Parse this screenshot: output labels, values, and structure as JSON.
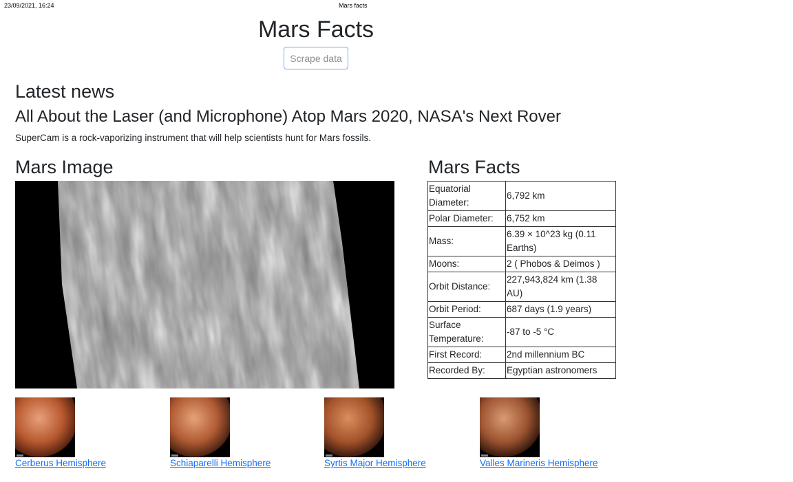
{
  "print_header": {
    "date": "23/09/2021, 16:24",
    "title": "Mars facts"
  },
  "page_title": "Mars Facts",
  "scrape_button": "Scrape data",
  "news": {
    "heading": "Latest news",
    "title": "All About the Laser (and Microphone) Atop Mars 2020, NASA's Next Rover",
    "paragraph": "SuperCam is a rock-vaporizing instrument that will help scientists hunt for Mars fossils."
  },
  "image_section": {
    "heading": "Mars Image"
  },
  "facts_section": {
    "heading": "Mars Facts",
    "rows": [
      {
        "label": "Equatorial Diameter:",
        "value": "6,792 km"
      },
      {
        "label": "Polar Diameter:",
        "value": "6,752 km"
      },
      {
        "label": "Mass:",
        "value": "6.39 × 10^23 kg (0.11 Earths)"
      },
      {
        "label": "Moons:",
        "value": "2 ( Phobos & Deimos )"
      },
      {
        "label": "Orbit Distance:",
        "value": "227,943,824 km (1.38 AU)"
      },
      {
        "label": "Orbit Period:",
        "value": "687 days (1.9 years)"
      },
      {
        "label": "Surface Temperature:",
        "value": "-87 to -5 °C"
      },
      {
        "label": "First Record:",
        "value": "2nd millennium BC"
      },
      {
        "label": "Recorded By:",
        "value": "Egyptian astronomers"
      }
    ]
  },
  "hemispheres": [
    {
      "title": "Cerberus Hemisphere",
      "colors": [
        "#e8a07a",
        "#b8592f",
        "#5a2412"
      ]
    },
    {
      "title": "Schiaparelli Hemisphere",
      "colors": [
        "#e6a27a",
        "#b05a33",
        "#4d2414"
      ]
    },
    {
      "title": "Syrtis Major Hemisphere",
      "colors": [
        "#d98f5e",
        "#a3522a",
        "#3f1d10"
      ]
    },
    {
      "title": "Valles Marineris Hemisphere",
      "colors": [
        "#d99a72",
        "#9c5430",
        "#3a1c10"
      ]
    }
  ]
}
